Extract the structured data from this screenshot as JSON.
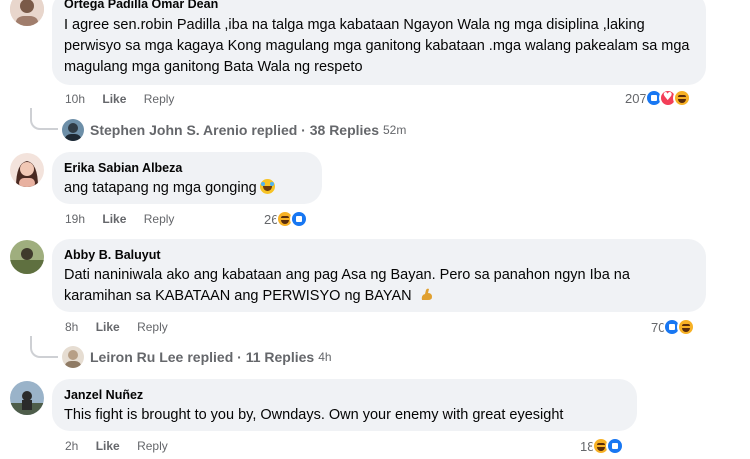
{
  "comments": [
    {
      "author": "Ortega Padilla Omar Dean",
      "text": "I agree sen.robin Padilla ,iba na talga mga kabataan Ngayon Wala ng mga disiplina ,laking perwisyo sa mga kagaya Kong magulang mga ganitong kabataan .mga walang pakealam sa mga magulang mga ganitong Bata Wala ng respeto",
      "time": "10h",
      "like": "Like",
      "reply": "Reply",
      "reaction_count": "207",
      "reactions": [
        "like",
        "love",
        "haha"
      ],
      "replies": {
        "name": "Stephen John S. Arenio",
        "label": "replied · 38 Replies",
        "time": "52m"
      }
    },
    {
      "author": "Erika Sabian Albeza",
      "text": "ang tatapang ng mga gonging",
      "emoji": "laughing-face",
      "time": "19h",
      "like": "Like",
      "reply": "Reply",
      "reaction_count": "26",
      "reactions": [
        "haha",
        "like"
      ]
    },
    {
      "author": "Abby B. Baluyut",
      "text": "Dati naniniwala ako ang kabataan ang pag Asa ng Bayan. Pero sa panahon ngyn Iba na karamihan sa KABATAAN ang PERWISYO ng BAYAN",
      "emoji": "flexed-biceps",
      "time": "8h",
      "like": "Like",
      "reply": "Reply",
      "reaction_count": "70",
      "reactions": [
        "like",
        "haha"
      ],
      "replies": {
        "name": "Leiron Ru Lee",
        "label": "replied · 11 Replies",
        "time": "4h"
      }
    },
    {
      "author": "Janzel Nuñez",
      "text": "This fight is brought to you by, Owndays. Own your enemy with great eyesight",
      "time": "2h",
      "like": "Like",
      "reply": "Reply",
      "reaction_count": "18",
      "reactions": [
        "haha",
        "like"
      ]
    }
  ],
  "colors": {
    "bubble": "#f0f2f5",
    "meta": "#65676b",
    "like": "#1877f2",
    "love": "#f33e58",
    "haha": "#f7b125"
  }
}
